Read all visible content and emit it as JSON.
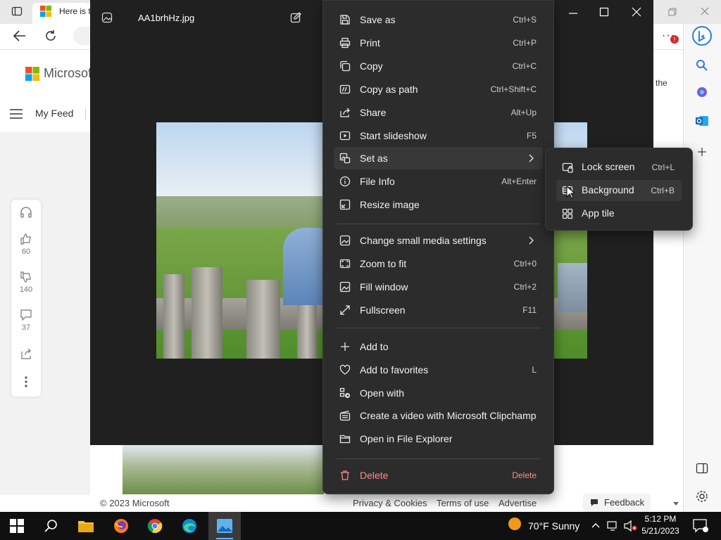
{
  "browser": {
    "tab_title": "Here is t",
    "toolbar_badge": "!"
  },
  "page": {
    "logo_text": "Microsoft",
    "nav_my_feed": "My Feed",
    "right_text": "the",
    "reactions": {
      "likes": "60",
      "dislikes": "140",
      "comments": "37"
    },
    "footer": {
      "copyright": "© 2023 Microsoft",
      "privacy": "Privacy & Cookies",
      "terms": "Terms of use",
      "advertise": "Advertise",
      "feedback": "Feedback"
    }
  },
  "photos": {
    "file_name": "AA1brhHz.jpg"
  },
  "context_menu": {
    "items": [
      {
        "label": "Save as",
        "shortcut": "Ctrl+S",
        "icon": "save-icon"
      },
      {
        "label": "Print",
        "shortcut": "Ctrl+P",
        "icon": "print-icon"
      },
      {
        "label": "Copy",
        "shortcut": "Ctrl+C",
        "icon": "copy-icon"
      },
      {
        "label": "Copy as path",
        "shortcut": "Ctrl+Shift+C",
        "icon": "copy-path-icon"
      },
      {
        "label": "Share",
        "shortcut": "Alt+Up",
        "icon": "share-icon"
      },
      {
        "label": "Start slideshow",
        "shortcut": "F5",
        "icon": "slideshow-icon"
      },
      {
        "label": "Set as",
        "shortcut": "",
        "icon": "set-as-icon"
      },
      {
        "label": "File Info",
        "shortcut": "Alt+Enter",
        "icon": "info-icon"
      },
      {
        "label": "Resize image",
        "shortcut": "",
        "icon": "resize-icon"
      },
      {
        "label": "Change small media settings",
        "shortcut": "",
        "icon": "media-settings-icon"
      },
      {
        "label": "Zoom to fit",
        "shortcut": "Ctrl+0",
        "icon": "zoom-fit-icon"
      },
      {
        "label": "Fill window",
        "shortcut": "Ctrl+2",
        "icon": "fill-window-icon"
      },
      {
        "label": "Fullscreen",
        "shortcut": "F11",
        "icon": "fullscreen-icon"
      },
      {
        "label": "Add to",
        "shortcut": "",
        "icon": "plus-icon"
      },
      {
        "label": "Add to favorites",
        "shortcut": "L",
        "icon": "heart-icon"
      },
      {
        "label": "Open with",
        "shortcut": "",
        "icon": "open-with-icon"
      },
      {
        "label": "Create a video with Microsoft Clipchamp",
        "shortcut": "",
        "icon": "clipchamp-icon"
      },
      {
        "label": "Open in File Explorer",
        "shortcut": "",
        "icon": "folder-icon"
      },
      {
        "label": "Delete",
        "shortcut": "Delete",
        "icon": "trash-icon"
      }
    ]
  },
  "submenu": {
    "items": [
      {
        "label": "Lock screen",
        "shortcut": "Ctrl+L",
        "icon": "lock-screen-icon"
      },
      {
        "label": "Background",
        "shortcut": "Ctrl+B",
        "icon": "background-icon"
      },
      {
        "label": "App tile",
        "shortcut": "",
        "icon": "app-tile-icon"
      }
    ]
  },
  "taskbar": {
    "weather": "70°F  Sunny",
    "time": "5:12 PM",
    "date": "5/21/2023"
  },
  "colors": {
    "menu_bg": "#2c2c2c",
    "delete_red": "#ff8a8a",
    "taskbar_bg": "#101010"
  }
}
